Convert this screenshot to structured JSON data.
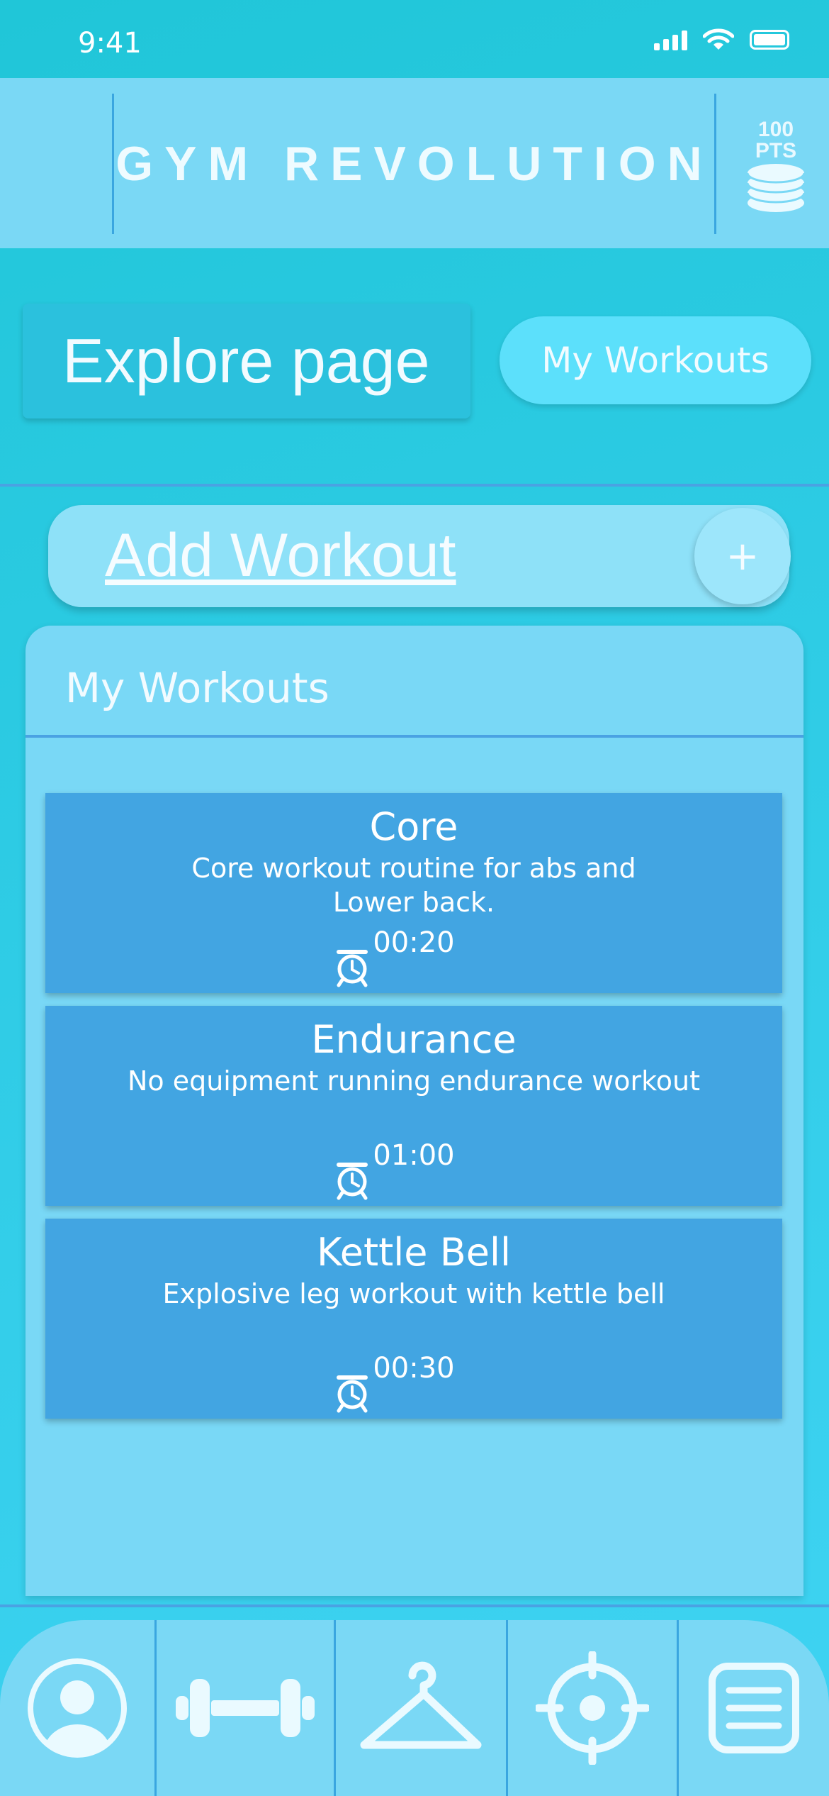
{
  "status_bar": {
    "time": "9:41"
  },
  "header": {
    "title": "GYM REVOLUTION",
    "points_value": "100",
    "points_unit": "PTS",
    "coins_icon": "coin-stack-icon"
  },
  "tabs": {
    "explore_label": "Explore page",
    "my_workouts_label": "My Workouts"
  },
  "add_workout": {
    "label": "Add Workout",
    "button_symbol": "+"
  },
  "panel": {
    "title": "My Workouts"
  },
  "workouts": [
    {
      "name": "Core",
      "description": "Core workout routine for abs and Lower back.",
      "duration": "00:20"
    },
    {
      "name": "Endurance",
      "description": "No equipment running endurance workout",
      "duration": "01:00"
    },
    {
      "name": "Kettle Bell",
      "description": "Explosive leg workout with kettle bell",
      "duration": "00:30"
    }
  ],
  "bottom_nav": [
    {
      "icon": "profile-icon"
    },
    {
      "icon": "dumbbell-icon"
    },
    {
      "icon": "hanger-icon"
    },
    {
      "icon": "target-icon"
    },
    {
      "icon": "menu-list-icon"
    }
  ],
  "colors": {
    "background": "#2dcbe4",
    "header": "#7ad8f5",
    "card": "#42a5e2",
    "divider": "#4aa2e3",
    "pill": "#5ce0fb"
  }
}
